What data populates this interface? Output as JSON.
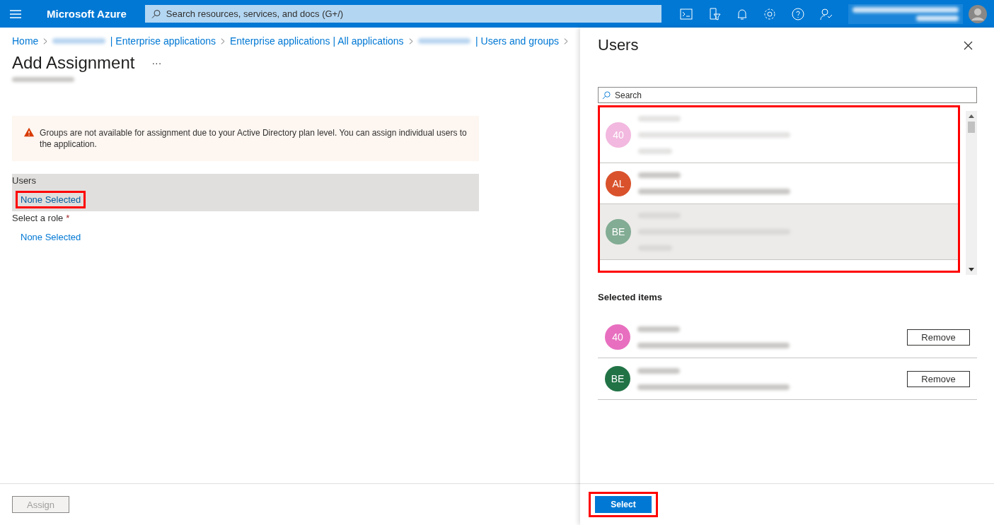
{
  "topbar": {
    "brand": "Microsoft Azure",
    "search": {
      "placeholder": "Search resources, services, and docs (G+/)"
    }
  },
  "breadcrumb": [
    {
      "label": "Home",
      "redacted": false
    },
    {
      "label": "| Enterprise applications",
      "redacted": true
    },
    {
      "label": "Enterprise applications | All applications",
      "redacted": false
    },
    {
      "label": "| Users and groups",
      "redacted": true
    }
  ],
  "page": {
    "title": "Add Assignment",
    "more": "···"
  },
  "warning": {
    "text": "Groups are not available for assignment due to your Active Directory plan level. You can assign individual users to the application."
  },
  "fields": [
    {
      "label": "Users",
      "value": "None Selected",
      "active": true,
      "highlighted": true
    },
    {
      "label": "Select a role",
      "required_mark": "*",
      "value": "None Selected",
      "active": false,
      "highlighted": false
    }
  ],
  "footer": {
    "assign": {
      "label": "Assign",
      "disabled": true
    }
  },
  "panel": {
    "title": "Users",
    "search": {
      "placeholder": "Search"
    },
    "list_highlighted": true,
    "users": [
      {
        "initials": "40",
        "color": "#f2b8df",
        "selected": true,
        "hovered": false
      },
      {
        "initials": "AL",
        "color": "#d9522c",
        "selected": false,
        "hovered": false
      },
      {
        "initials": "BE",
        "color": "#82ac94",
        "selected": true,
        "hovered": true
      }
    ],
    "selected_heading": "Selected items",
    "selected_items": [
      {
        "initials": "40",
        "color": "#e86fbf",
        "action": "Remove"
      },
      {
        "initials": "BE",
        "color": "#217346",
        "action": "Remove"
      }
    ],
    "select": {
      "label": "Select",
      "highlighted": true
    }
  }
}
